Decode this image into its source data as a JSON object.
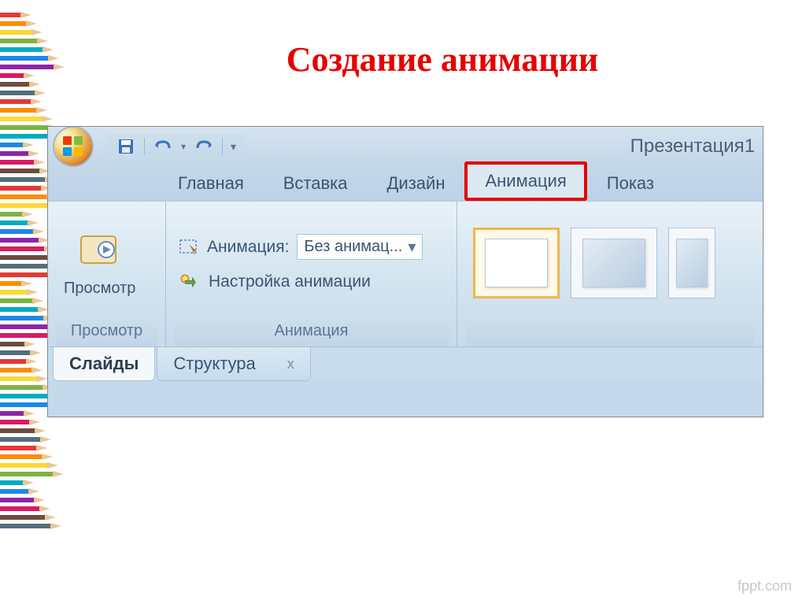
{
  "slide": {
    "title": "Создание анимации"
  },
  "app": {
    "title": "Презентация1"
  },
  "tabs": {
    "home": "Главная",
    "insert": "Вставка",
    "design": "Дизайн",
    "animation": "Анимация",
    "slideshow": "Показ "
  },
  "ribbon": {
    "preview_group": "Просмотр",
    "preview_btn": "Просмотр",
    "anim_group": "Анимация",
    "anim_label": "Анимация:",
    "anim_value": "Без анимац...",
    "anim_custom": "Настройка анимации"
  },
  "bottom_tabs": {
    "slides": "Слайды",
    "outline": "Структура",
    "close": "x"
  },
  "watermark": "fppt.com",
  "pencil_colors": [
    "#e53935",
    "#fb8c00",
    "#fdd835",
    "#7cb342",
    "#00acc1",
    "#1e88e5",
    "#8e24aa",
    "#d81b60",
    "#6d4c41",
    "#546e7a"
  ]
}
